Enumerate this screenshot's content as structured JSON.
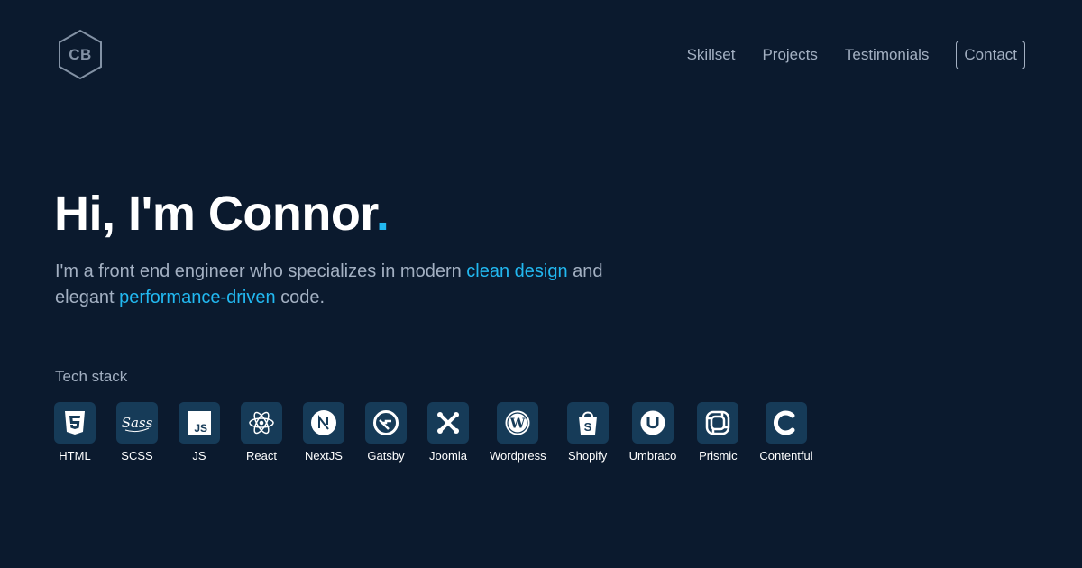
{
  "logo": {
    "text": "CB"
  },
  "nav": {
    "items": [
      "Skillset",
      "Projects",
      "Testimonials"
    ],
    "contact": "Contact"
  },
  "hero": {
    "title_main": "Hi, I'm Connor",
    "title_dot": ".",
    "sub_1": "I'm a front end engineer who specializes in modern ",
    "sub_highlight_1": "clean design",
    "sub_2": " and elegant ",
    "sub_highlight_2": "performance-driven",
    "sub_3": " code."
  },
  "tech": {
    "label": "Tech stack",
    "items": [
      {
        "name": "HTML",
        "icon": "html5-icon"
      },
      {
        "name": "SCSS",
        "icon": "sass-icon"
      },
      {
        "name": "JS",
        "icon": "javascript-icon"
      },
      {
        "name": "React",
        "icon": "react-icon"
      },
      {
        "name": "NextJS",
        "icon": "nextjs-icon"
      },
      {
        "name": "Gatsby",
        "icon": "gatsby-icon"
      },
      {
        "name": "Joomla",
        "icon": "joomla-icon"
      },
      {
        "name": "Wordpress",
        "icon": "wordpress-icon"
      },
      {
        "name": "Shopify",
        "icon": "shopify-icon"
      },
      {
        "name": "Umbraco",
        "icon": "umbraco-icon"
      },
      {
        "name": "Prismic",
        "icon": "prismic-icon"
      },
      {
        "name": "Contentful",
        "icon": "contentful-icon"
      }
    ]
  },
  "colors": {
    "background": "#0b1a2e",
    "accent": "#22b8f0",
    "muted_text": "#a3b0c2",
    "icon_tile": "#163b58"
  }
}
